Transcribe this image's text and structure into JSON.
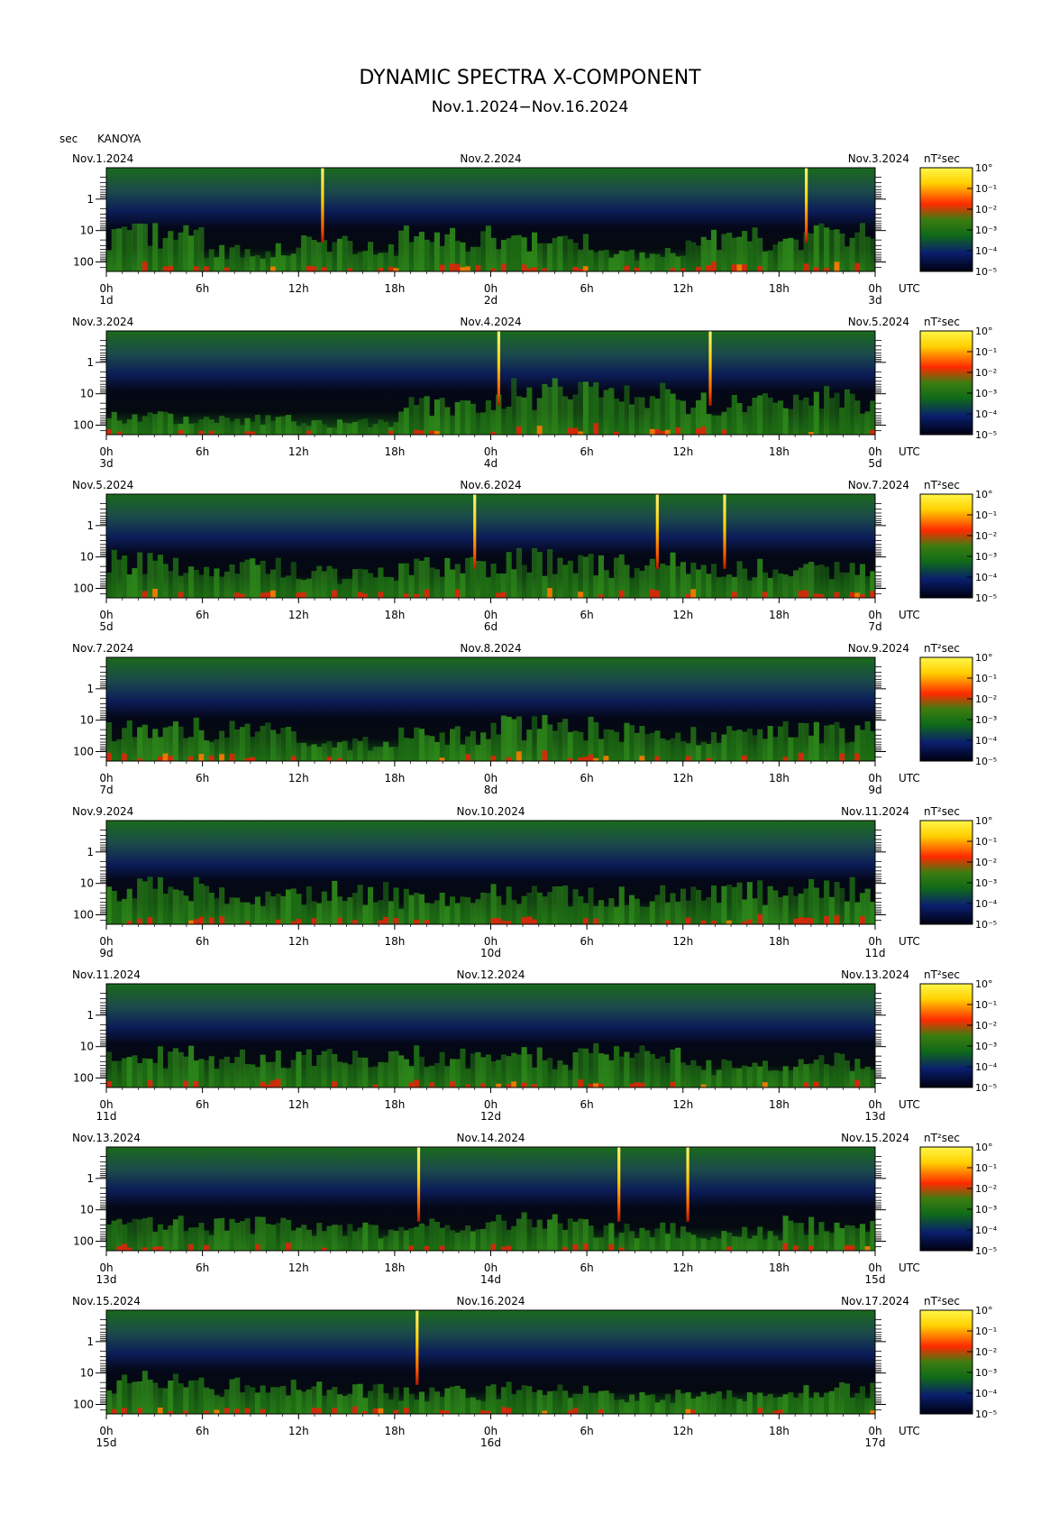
{
  "title": "DYNAMIC SPECTRA X-COMPONENT",
  "subtitle": "Nov.1.2024−Nov.16.2024",
  "yunit": "sec",
  "station": "KANOYA",
  "colorbar_unit": "nT²sec",
  "chart_data": {
    "type": "heatmap",
    "x_ticks": [
      "0h",
      "6h",
      "12h",
      "18h",
      "0h",
      "6h",
      "12h",
      "18h",
      "0h"
    ],
    "x_unit": "UTC",
    "y_ticks": [
      "1",
      "10",
      "100"
    ],
    "y_scale": "log",
    "colorbar_ticks": [
      "10°",
      "10⁻¹",
      "10⁻²",
      "10⁻³",
      "10⁻⁴",
      "10⁻⁵"
    ],
    "colormap": [
      "#000010",
      "#0a1f6e",
      "#166c1a",
      "#3f8a18",
      "#ff2a00",
      "#ffd000",
      "#fff64a"
    ],
    "panels": [
      {
        "date_left": "Nov.1.2024",
        "date_mid": "Nov.2.2024",
        "date_right": "Nov.3.2024",
        "day_left": "1d",
        "day_mid": "2d",
        "day_right": "3d",
        "spikes_hours": [
          13.5,
          43.7
        ],
        "activity": [
          0.62,
          0.35,
          0.45,
          0.58,
          0.5,
          0.3,
          0.55,
          0.6
        ]
      },
      {
        "date_left": "Nov.3.2024",
        "date_mid": "Nov.4.2024",
        "date_right": "Nov.5.2024",
        "day_left": "3d",
        "day_mid": "4d",
        "day_right": "5d",
        "spikes_hours": [
          24.5,
          37.7
        ],
        "activity": [
          0.3,
          0.25,
          0.2,
          0.5,
          0.72,
          0.65,
          0.55,
          0.6
        ]
      },
      {
        "date_left": "Nov.5.2024",
        "date_mid": "Nov.6.2024",
        "date_right": "Nov.7.2024",
        "day_left": "5d",
        "day_mid": "6d",
        "day_right": "7d",
        "spikes_hours": [
          23.0,
          34.4,
          38.6
        ],
        "activity": [
          0.6,
          0.5,
          0.4,
          0.55,
          0.62,
          0.58,
          0.5,
          0.45
        ]
      },
      {
        "date_left": "Nov.7.2024",
        "date_mid": "Nov.8.2024",
        "date_right": "Nov.9.2024",
        "day_left": "7d",
        "day_mid": "8d",
        "day_right": "9d",
        "spikes_hours": [],
        "activity": [
          0.55,
          0.5,
          0.3,
          0.45,
          0.6,
          0.55,
          0.45,
          0.5
        ]
      },
      {
        "date_left": "Nov.9.2024",
        "date_mid": "Nov.10.2024",
        "date_right": "Nov.11.2024",
        "day_left": "9d",
        "day_mid": "10d",
        "day_right": "11d",
        "spikes_hours": [],
        "activity": [
          0.6,
          0.5,
          0.55,
          0.45,
          0.5,
          0.5,
          0.55,
          0.6
        ]
      },
      {
        "date_left": "Nov.11.2024",
        "date_mid": "Nov.12.2024",
        "date_right": "Nov.13.2024",
        "day_left": "11d",
        "day_mid": "12d",
        "day_right": "13d",
        "spikes_hours": [],
        "activity": [
          0.55,
          0.5,
          0.5,
          0.55,
          0.5,
          0.55,
          0.35,
          0.45
        ]
      },
      {
        "date_left": "Nov.13.2024",
        "date_mid": "Nov.14.2024",
        "date_right": "Nov.15.2024",
        "day_left": "13d",
        "day_mid": "14d",
        "day_right": "15d",
        "spikes_hours": [
          19.5,
          32.0,
          36.3
        ],
        "activity": [
          0.55,
          0.45,
          0.35,
          0.4,
          0.5,
          0.35,
          0.3,
          0.45
        ]
      },
      {
        "date_left": "Nov.15.2024",
        "date_mid": "Nov.16.2024",
        "date_right": "Nov.17.2024",
        "day_left": "15d",
        "day_mid": "16d",
        "day_right": "17d",
        "spikes_hours": [
          19.4
        ],
        "activity": [
          0.55,
          0.45,
          0.4,
          0.35,
          0.4,
          0.3,
          0.3,
          0.4
        ]
      }
    ]
  }
}
